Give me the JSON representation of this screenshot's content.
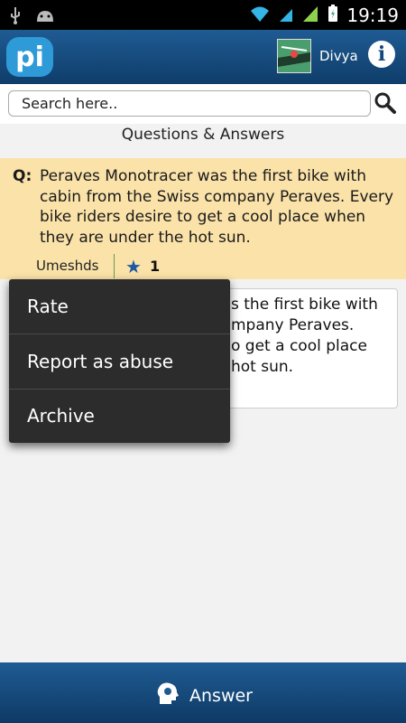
{
  "status_bar": {
    "time": "19:19"
  },
  "app_bar": {
    "logo_text": "pi",
    "user_name": "Divya",
    "info_icon": "info-icon"
  },
  "search": {
    "placeholder": "Search here.."
  },
  "section": {
    "title": "Questions & Answers"
  },
  "question": {
    "label": "Q:",
    "text": "Peraves Monotracer was the first bike with cabin from the Swiss company Peraves. Every bike riders desire to get a cool place when they are under the hot sun.",
    "author": "Umeshds",
    "rating": "1"
  },
  "answer_preview": {
    "line1": "s the first bike with",
    "line2": "mpany Peraves.",
    "line3": "o get a cool place",
    "line4": "hot sun."
  },
  "context_menu": {
    "items": [
      "Rate",
      "Report as abuse",
      "Archive"
    ]
  },
  "bottom_bar": {
    "answer_label": "Answer"
  },
  "colors": {
    "accent": "#1f5b93",
    "question_bg": "#fae2a9",
    "menu_bg": "#2c2c2c"
  }
}
